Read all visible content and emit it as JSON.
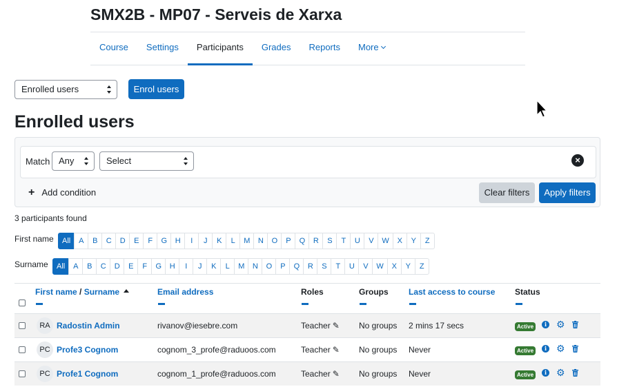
{
  "course": {
    "title": "SMX2B - MP07 - Serveis de Xarxa"
  },
  "nav": {
    "items": [
      "Course",
      "Settings",
      "Participants",
      "Grades",
      "Reports",
      "More"
    ]
  },
  "toolbar": {
    "select_value": "Enrolled users",
    "enrol_label": "Enrol users"
  },
  "page": {
    "heading": "Enrolled users"
  },
  "filter": {
    "match_label": "Match",
    "match_value": "Any",
    "select_value": "Select",
    "add_condition": "Add condition",
    "clear_label": "Clear filters",
    "apply_label": "Apply filters"
  },
  "summary": "3 participants found",
  "initials": {
    "firstname_label": "First name",
    "surname_label": "Surname",
    "all_label": "All",
    "letters": [
      "A",
      "B",
      "C",
      "D",
      "E",
      "F",
      "G",
      "H",
      "I",
      "J",
      "K",
      "L",
      "M",
      "N",
      "O",
      "P",
      "Q",
      "R",
      "S",
      "T",
      "U",
      "V",
      "W",
      "X",
      "Y",
      "Z"
    ]
  },
  "table": {
    "headers": {
      "firstname": "First name",
      "separator": " / ",
      "surname": "Surname",
      "email": "Email address",
      "roles": "Roles",
      "groups": "Groups",
      "lastaccess": "Last access to course",
      "status": "Status"
    },
    "rows": [
      {
        "initials": "RA",
        "name": "Radostin Admin",
        "email": "rivanov@iesebre.com",
        "role": "Teacher",
        "groups": "No groups",
        "lastaccess": "2 mins 17 secs",
        "status": "Active"
      },
      {
        "initials": "PC",
        "name": "Profe3 Cognom",
        "email": "cognom_3_profe@raduoos.com",
        "role": "Teacher",
        "groups": "No groups",
        "lastaccess": "Never",
        "status": "Active"
      },
      {
        "initials": "PC",
        "name": "Profe1 Cognom",
        "email": "cognom_1_profe@raduoos.com",
        "role": "Teacher",
        "groups": "No groups",
        "lastaccess": "Never",
        "status": "Active"
      }
    ]
  },
  "colors": {
    "primary": "#0f6cbf",
    "active_badge": "#357a32",
    "row_shade": "#f2f2f2"
  },
  "icons": [
    "caret-down-icon",
    "updown-icon",
    "close-icon",
    "plus-icon",
    "sort-up-icon",
    "pencil-icon",
    "info-icon",
    "gear-icon",
    "trash-icon",
    "mouse-cursor-icon"
  ]
}
